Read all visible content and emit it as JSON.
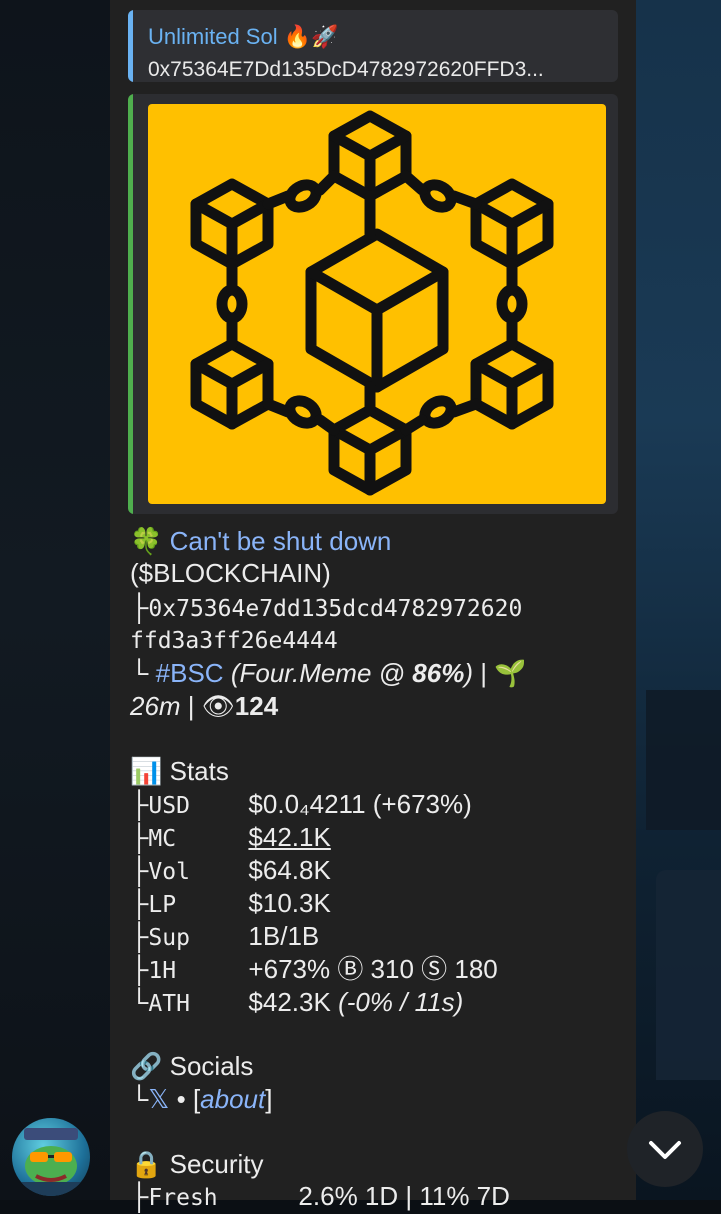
{
  "reply": {
    "title": "Unlimited Sol 🔥🚀",
    "address": "0x75364E7Dd135DcD4782972620FFD3..."
  },
  "token": {
    "clover_emoji": "🍀",
    "name_link": "Can't be shut down",
    "ticker": "($BLOCKCHAIN)",
    "branch1": "├",
    "address_part1": "0x75364e7dd135dcd4782972620",
    "address_part2": "ffd3a3ff26e4444",
    "branch2": "└",
    "chain_tag": "#BSC",
    "platform": "(Four.Meme @ ",
    "platform_pct": "86%",
    "platform_close": ")",
    "separator": " | ",
    "seedling": "🌱",
    "age": "26m",
    "age_sep": " | ",
    "eye": "👁",
    "views": "124"
  },
  "stats": {
    "icon": "📊",
    "title": "Stats",
    "rows": [
      {
        "branch": "├",
        "label": "USD",
        "value": "$0.0₄4211 (+673%)"
      },
      {
        "branch": "├",
        "label": "MC",
        "value": "$42.1K"
      },
      {
        "branch": "├",
        "label": "Vol",
        "value": "$64.8K"
      },
      {
        "branch": "├",
        "label": "LP",
        "value": "$10.3K"
      },
      {
        "branch": "├",
        "label": "Sup",
        "value": "1B/1B"
      },
      {
        "branch": "├",
        "label": "1H",
        "value": "+673% Ⓑ 310 Ⓢ 180"
      },
      {
        "branch": "└",
        "label": "ATH",
        "value": "$42.3K",
        "value_extra": "(-0% / 11s)"
      }
    ]
  },
  "socials": {
    "icon": "🔗",
    "title": "Socials",
    "branch": "└",
    "x_glyph": "𝕏",
    "dot": " • ",
    "open": "[",
    "about": "about",
    "close": "]"
  },
  "security": {
    "icon": "🔒",
    "title": "Security",
    "partial_label": "Fresh",
    "partial_value": "2.6% 1D | 11% 7D"
  },
  "colors": {
    "accent": "#8ab4f8",
    "reply_bar": "#6ab2f2",
    "preview_bar": "#4fae4e",
    "image_bg": "#ffc000",
    "bubble_bg": "#212121"
  },
  "icons": {
    "scroll": "chevron-down-icon",
    "avatar": "pepe-avatar"
  }
}
